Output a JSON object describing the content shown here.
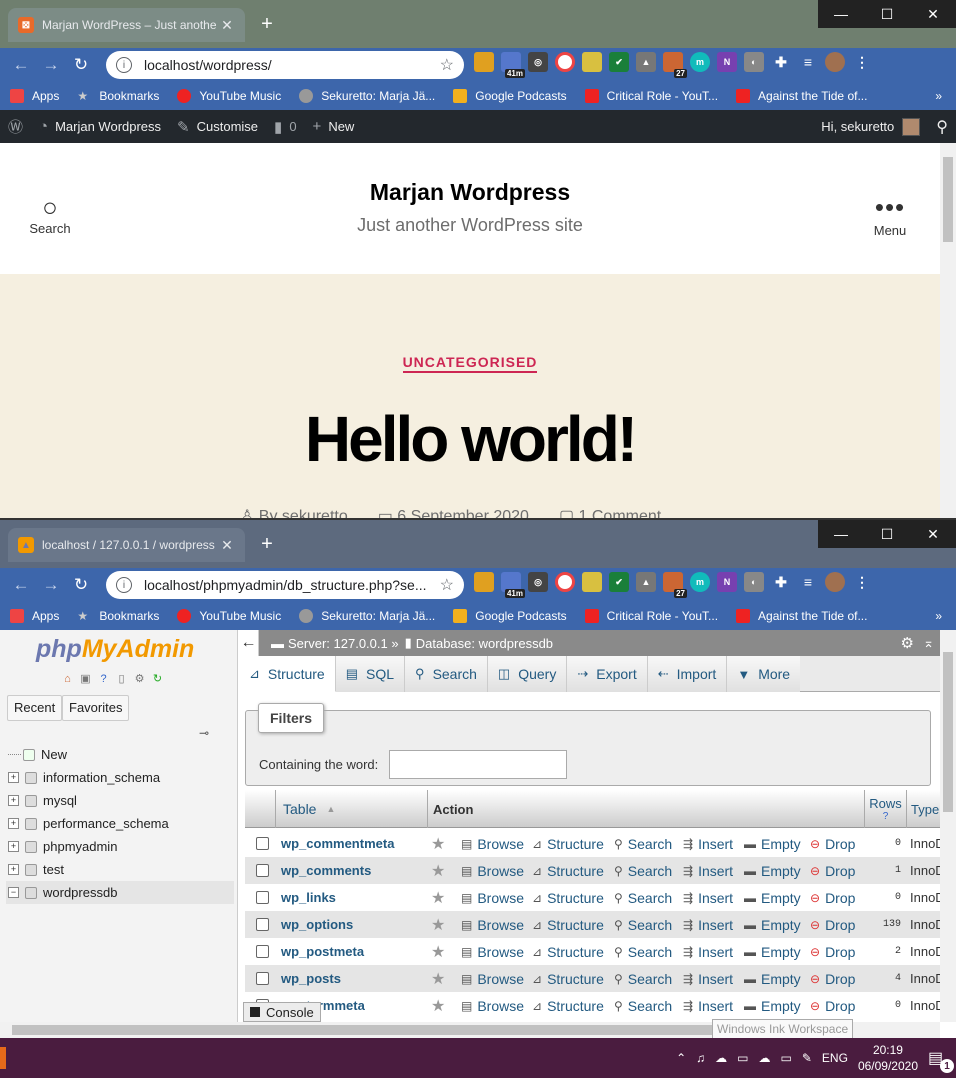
{
  "browser1": {
    "tab_title": "Marjan WordPress – Just anothe",
    "url": "localhost/wordpress/"
  },
  "browser2": {
    "tab_title": "localhost / 127.0.0.1 / wordpress",
    "url": "localhost/phpmyadmin/db_structure.php?se..."
  },
  "bookmarks": [
    "Apps",
    "Bookmarks",
    "YouTube Music",
    "Sekuretto: Marja Jä...",
    "Google Podcasts",
    "Critical Role - YouT...",
    "Against the Tide of..."
  ],
  "extensions": {
    "badge1": "41m",
    "badge2": "27"
  },
  "wp_admin_bar": {
    "site": "Marjan Wordpress",
    "customise": "Customise",
    "comments": "0",
    "new": "New",
    "greeting": "Hi, sekuretto"
  },
  "wp_page": {
    "search": "Search",
    "site_title": "Marjan Wordpress",
    "tagline": "Just another WordPress site",
    "menu": "Menu",
    "category": "UNCATEGORISED",
    "post_title": "Hello world!",
    "meta_author": "By sekuretto",
    "meta_date": "6 September 2020",
    "meta_comments": "1 Comment"
  },
  "pma": {
    "logo_php": "php",
    "logo_my": "MyAdmin",
    "btn_recent": "Recent",
    "btn_favorites": "Favorites",
    "tree": [
      "New",
      "information_schema",
      "mysql",
      "performance_schema",
      "phpmyadmin",
      "test",
      "wordpressdb"
    ],
    "crumb_server": "Server: 127.0.0.1 »",
    "crumb_db": "Database: wordpressdb",
    "tabs": [
      "Structure",
      "SQL",
      "Search",
      "Query",
      "Export",
      "Import",
      "More"
    ],
    "filters_legend": "Filters",
    "filters_label": "Containing the word:",
    "col_table": "Table",
    "col_action": "Action",
    "col_rows": "Rows",
    "col_type": "Type",
    "actions": [
      "Browse",
      "Structure",
      "Search",
      "Insert",
      "Empty",
      "Drop"
    ],
    "rows": [
      {
        "name": "wp_commentmeta",
        "rows": "0",
        "type": "InnoDB"
      },
      {
        "name": "wp_comments",
        "rows": "1",
        "type": "InnoDB"
      },
      {
        "name": "wp_links",
        "rows": "0",
        "type": "InnoDB"
      },
      {
        "name": "wp_options",
        "rows": "139",
        "type": "InnoDB"
      },
      {
        "name": "wp_postmeta",
        "rows": "2",
        "type": "InnoDB"
      },
      {
        "name": "wp_posts",
        "rows": "4",
        "type": "InnoDB"
      },
      {
        "name": "wp_termmeta",
        "rows": "0",
        "type": "InnoDB"
      }
    ],
    "console": "Console",
    "tooltip": "Windows Ink Workspace"
  },
  "taskbar": {
    "lang": "ENG",
    "time": "20:19",
    "date": "06/09/2020",
    "notif_count": "1"
  }
}
